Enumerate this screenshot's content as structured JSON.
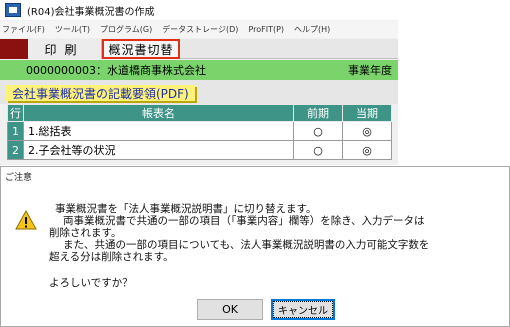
{
  "window": {
    "title": "(R04)会社事業概況書の作成"
  },
  "menu": [
    "ファイル(F)",
    "ツール(T)",
    "プログラム(G)",
    "データストレージ(D)",
    "ProFIT(P)",
    "ヘルプ(H)"
  ],
  "toolbar": {
    "print_label": "印刷",
    "switch_label": "概況書切替"
  },
  "company": {
    "code_name": "0000000003：水道橋商事株式会社",
    "year_label": "事業年度"
  },
  "section": {
    "title": "会社事業概況書の記載要領(PDF)"
  },
  "table": {
    "headers": {
      "row": "行",
      "name": "帳表名",
      "prev": "前期",
      "curr": "当期"
    },
    "rows": [
      {
        "num": "1",
        "name": "1.総括表",
        "prev": "○",
        "curr": "◎"
      },
      {
        "num": "2",
        "name": "2.子会社等の状況",
        "prev": "○",
        "curr": "◎"
      }
    ]
  },
  "dialog": {
    "title": "ご注意",
    "icon": "warning-icon",
    "lines": {
      "l1": "事業概況書を「法人事業概況説明書」に切り替えます。",
      "l2": "両事業概況書で共通の一部の項目（「事業内容」欄等）を除き、入力データは",
      "l3": "削除されます。",
      "l4": "また、共通の一部の項目についても、法人事業概況説明書の入力可能文字数を",
      "l5": "超える分は削除されます。",
      "ask": "よろしいですか？"
    },
    "ok_label": "OK",
    "cancel_label": "キャンセル"
  },
  "colors": {
    "green_bar": "#7bd36b",
    "teal_header": "#3f9488",
    "highlight": "#e03018",
    "yellow": "#fff27a"
  }
}
